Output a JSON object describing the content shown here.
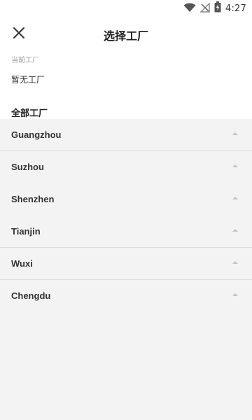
{
  "status_bar": {
    "time": "4:27",
    "icons": [
      "wifi-icon",
      "no-signal-icon",
      "battery-charging-icon"
    ]
  },
  "header": {
    "title": "选择工厂",
    "close_icon": "close-icon"
  },
  "current_factory": {
    "label": "当前工厂",
    "value": "暂无工厂"
  },
  "all_factories": {
    "label": "全部工厂",
    "items": [
      {
        "name": "Guangzhou",
        "arrow_icon": "caret-up-icon"
      },
      {
        "name": "Suzhou",
        "arrow_icon": "caret-up-icon"
      },
      {
        "name": "Shenzhen",
        "arrow_icon": "caret-up-icon"
      },
      {
        "name": "Tianjin",
        "arrow_icon": "caret-up-icon"
      },
      {
        "name": "Wuxi",
        "arrow_icon": "caret-up-icon"
      },
      {
        "name": "Chengdu",
        "arrow_icon": "caret-up-icon"
      }
    ]
  },
  "colors": {
    "background": "#ffffff",
    "list_background": "#f3f3f3",
    "divider": "#dedede",
    "text_primary": "#222222",
    "text_secondary": "#9a9a9a"
  }
}
